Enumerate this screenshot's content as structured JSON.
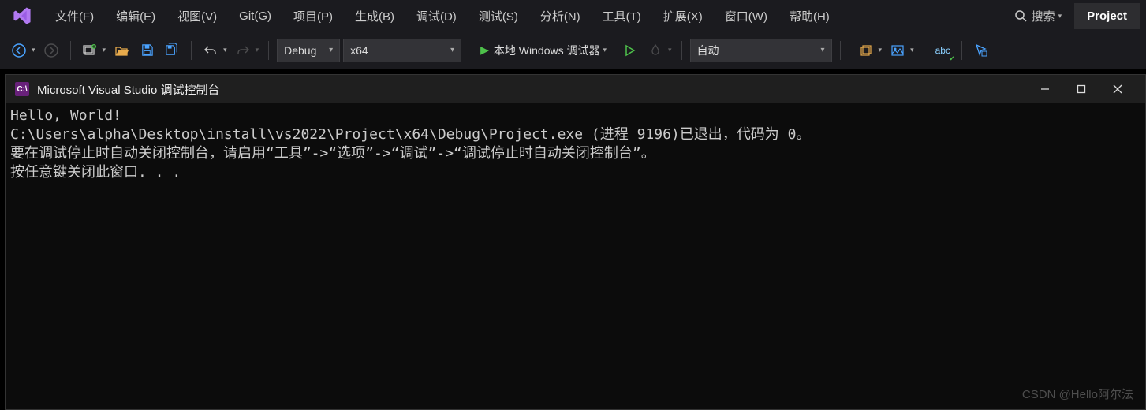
{
  "menubar": {
    "items": [
      "文件(F)",
      "编辑(E)",
      "视图(V)",
      "Git(G)",
      "项目(P)",
      "生成(B)",
      "调试(D)",
      "测试(S)",
      "分析(N)",
      "工具(T)",
      "扩展(X)",
      "窗口(W)",
      "帮助(H)"
    ],
    "search_label": "搜索",
    "project_label": "Project"
  },
  "toolbar": {
    "config": "Debug",
    "platform": "x64",
    "debugger_label": "本地 Windows 调试器",
    "auto_label": "自动",
    "abc_label": "abc"
  },
  "console": {
    "title": "Microsoft Visual Studio 调试控制台",
    "lines": [
      "Hello, World!",
      "C:\\Users\\alpha\\Desktop\\install\\vs2022\\Project\\x64\\Debug\\Project.exe (进程 9196)已退出，代码为 0。",
      "要在调试停止时自动关闭控制台，请启用“工具”->“选项”->“调试”->“调试停止时自动关闭控制台”。",
      "按任意键关闭此窗口. . ."
    ]
  },
  "watermark": "CSDN @Hello阿尔法"
}
